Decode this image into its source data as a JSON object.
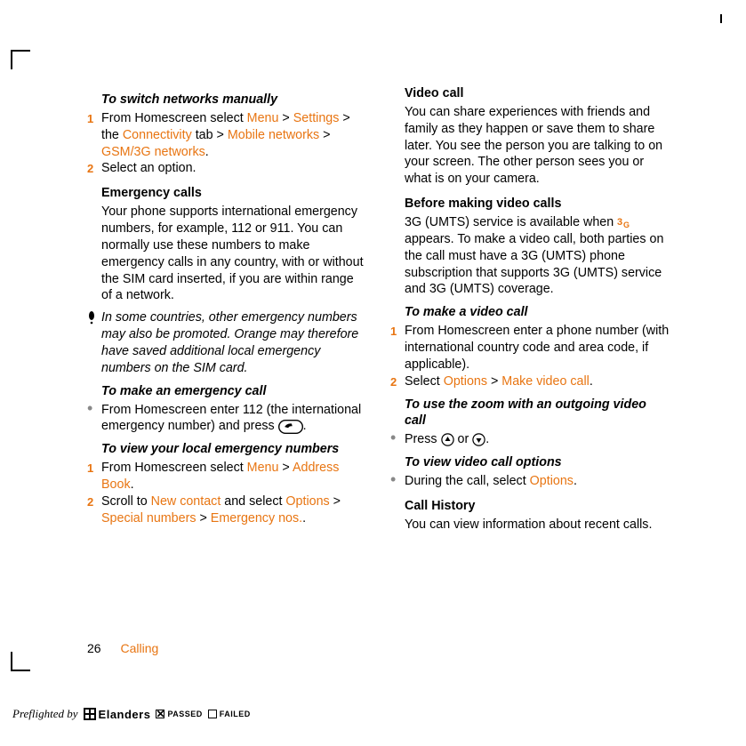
{
  "left": {
    "h_switch": "To switch networks manually",
    "sw1_a": "From Homescreen select ",
    "sw1_menu": "Menu",
    "sw1_gt1": " > ",
    "sw1_settings": "Settings",
    "sw1_gt2": " > the ",
    "sw1_conn": "Connectivity",
    "sw1_tab": " tab > ",
    "sw1_mobile": "Mobile networks",
    "sw1_gt3": " > ",
    "sw1_gsm": "GSM/3G networks",
    "sw1_dot": ".",
    "sw2": "Select an option.",
    "h_emerg": "Emergency calls",
    "emerg_p": "Your phone supports international emergency numbers, for example, 112 or 911. You can normally use these numbers to make emergency calls in any country, with or without the SIM card inserted, if you are within range of a network.",
    "note": "In some countries, other emergency numbers may also be promoted. Orange may therefore have saved additional local emergency numbers on the SIM card.",
    "h_make_em": "To make an emergency call",
    "make_em_a": "From Homescreen enter 112 (the international emergency number) and press ",
    "make_em_b": ".",
    "h_view_local": "To view your local emergency numbers",
    "vl1_a": "From Homescreen select ",
    "vl1_menu": "Menu",
    "vl1_gt": " > ",
    "vl1_addr": "Address Book",
    "vl1_dot": ".",
    "vl2_a": "Scroll to ",
    "vl2_new": "New contact",
    "vl2_b": " and select ",
    "vl2_opt": "Options",
    "vl2_gt1": " > ",
    "vl2_sp": "Special numbers",
    "vl2_gt2": " > ",
    "vl2_en": "Emergency nos.",
    "vl2_dot": "."
  },
  "right": {
    "h_video": "Video call",
    "video_p": "You can share experiences with friends and family as they happen or save them to share later. You see the person you are talking to on your screen. The other person sees you or what is on your camera.",
    "h_before": "Before making video calls",
    "before_a": "3G (UMTS) service is available when ",
    "before_b": " appears. To make a video call, both parties on the call must have a 3G (UMTS) phone subscription that supports 3G (UMTS) service and 3G (UMTS) coverage.",
    "h_make_v": "To make a video call",
    "mv1": "From Homescreen enter a phone number (with international country code and area code, if applicable).",
    "mv2_a": "Select ",
    "mv2_opt": "Options",
    "mv2_gt": " > ",
    "mv2_make": "Make video call",
    "mv2_dot": ".",
    "h_zoom": "To use the zoom with an outgoing video call",
    "zoom_a": "Press ",
    "zoom_or": " or ",
    "zoom_dot": ".",
    "h_vopt": "To view video call options",
    "vopt_a": "During the call, select ",
    "vopt_opt": "Options",
    "vopt_dot": ".",
    "h_hist": "Call History",
    "hist_p": "You can view information about recent calls."
  },
  "footer": {
    "page": "26",
    "section": "Calling"
  },
  "preflight": {
    "label": "Preflighted by",
    "brand": "Elanders",
    "passed": "PASSED",
    "failed": "FAILED"
  }
}
